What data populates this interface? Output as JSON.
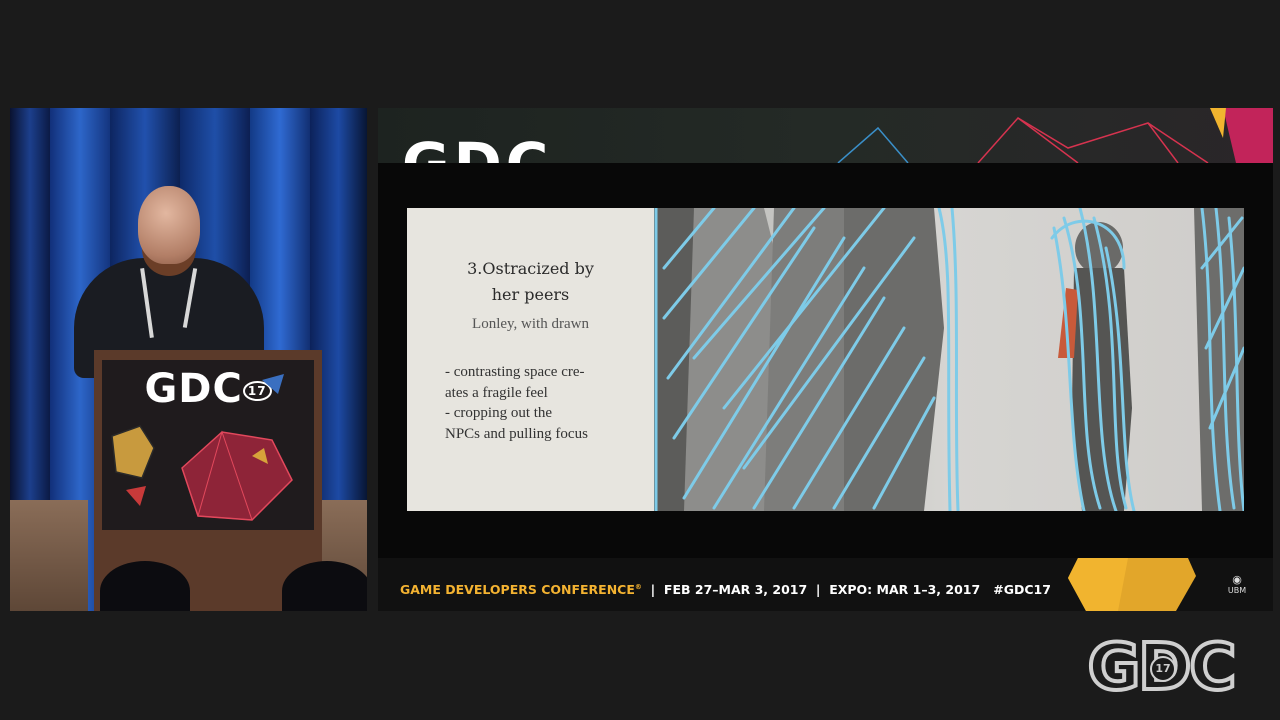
{
  "speaker_video": {
    "podium_logo": "GDC",
    "podium_logo_sub": "17"
  },
  "slide": {
    "header_logo": "GDC",
    "heading_line1": "3.Ostracized by",
    "heading_line2": "her peers",
    "subheading": "Lonley, with drawn",
    "bullets": [
      "- contrasting space cre-",
      "ates a fragile feel",
      "- cropping out the",
      "NPCs and pulling focus"
    ],
    "footer": {
      "conference": "GAME DEVELOPERS CONFERENCE",
      "trademark": "®",
      "separator": "|",
      "dates": "FEB 27–MAR 3, 2017",
      "expo": "EXPO: MAR 1–3, 2017",
      "hashtag": "#GDC17",
      "sponsor": "UBM"
    },
    "colors": {
      "accent_gold": "#f4b331",
      "scribble_blue": "#7ecbe8",
      "panel_bg": "#e7e5df"
    }
  },
  "watermark": {
    "text": "GDC",
    "sub": "17"
  }
}
